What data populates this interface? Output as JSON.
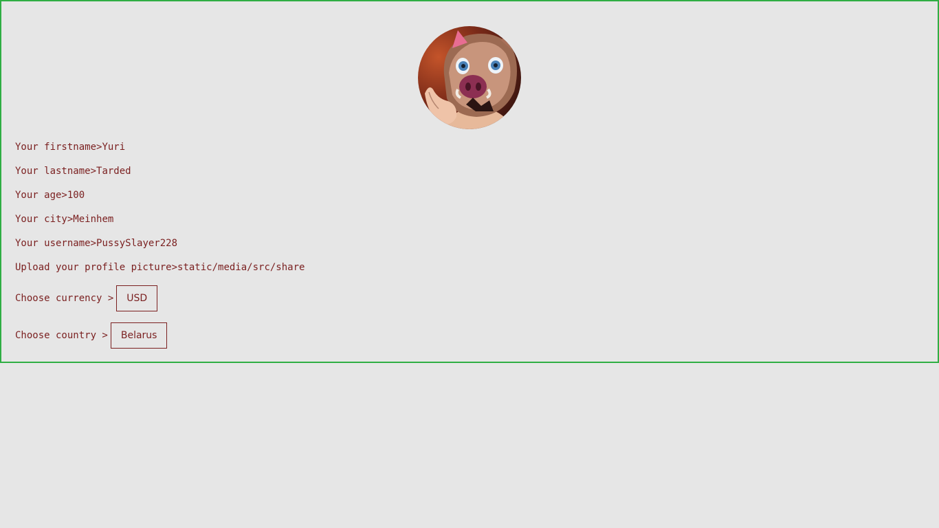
{
  "profile": {
    "avatar": {
      "icon": "avatar-boar-mask-image"
    },
    "fields": [
      {
        "label": "Your firstname>",
        "value": "Yuri"
      },
      {
        "label": "Your lastname>",
        "value": "Tarded"
      },
      {
        "label": "Your age>",
        "value": "100"
      },
      {
        "label": "Your city>",
        "value": "Meinhem"
      },
      {
        "label": "Your username>",
        "value": "PussySlayer228"
      }
    ],
    "upload": {
      "label": "Upload your profile picture>",
      "value": "static/media/src/share"
    },
    "currency": {
      "label": "Choose currency >",
      "selected": "USD"
    },
    "country": {
      "label": "Choose country >",
      "selected": "Belarus"
    }
  },
  "colors": {
    "background": "#e6e6e6",
    "text": "#7a1f1f",
    "panel_border": "#2fae43"
  }
}
